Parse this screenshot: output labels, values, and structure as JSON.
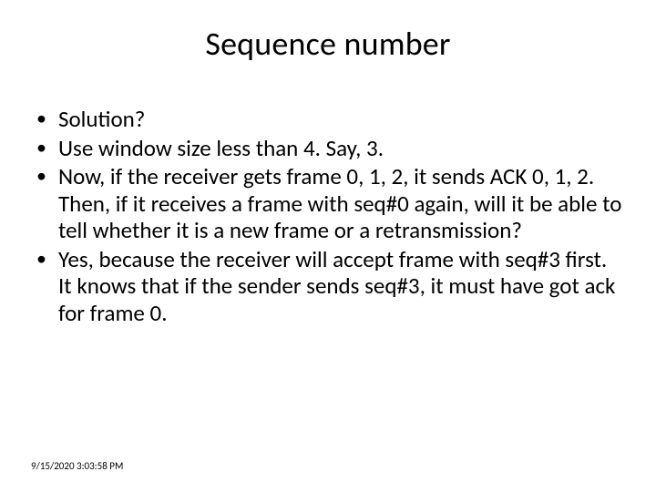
{
  "title": "Sequence number",
  "bullets": [
    "Solution?",
    "Use window size less than 4. Say, 3.",
    "Now, if the receiver gets frame 0, 1, 2, it sends ACK 0, 1, 2. Then, if it receives a frame with seq#0 again, will it be able to tell whether it is a new frame or a retransmission?",
    "Yes, because the receiver will accept frame with seq#3 first. It knows that if the sender sends seq#3, it must have got ack for frame 0."
  ],
  "footer": "9/15/2020 3:03:58 PM"
}
